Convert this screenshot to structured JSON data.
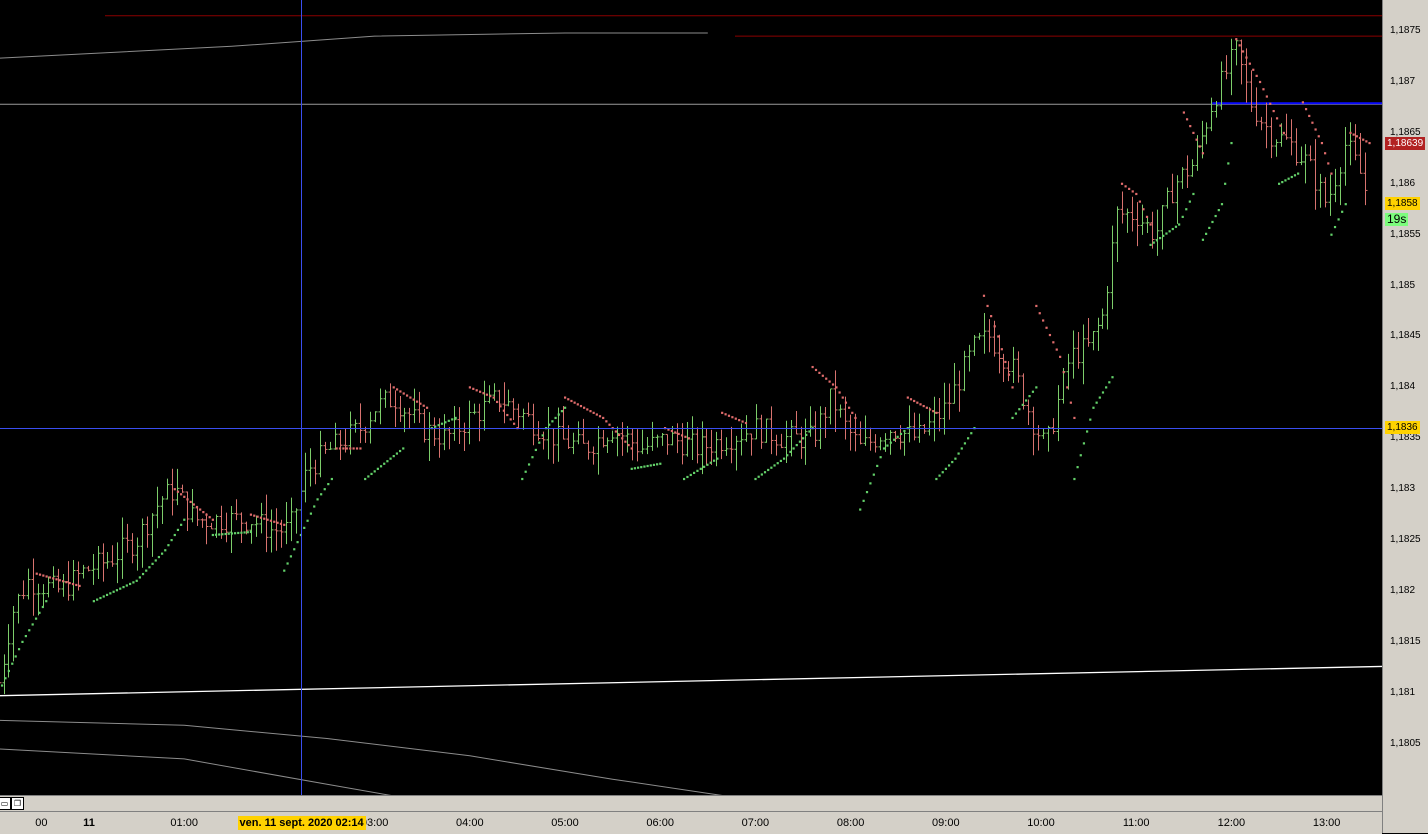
{
  "colors": {
    "background": "#000000",
    "bar_up": "#7ccd6a",
    "bar_down": "#d8736f",
    "sar_up": "#63d16a",
    "sar_down": "#e06c6c",
    "crosshair": "#3a4ef0",
    "resistance_line": "#8b0000",
    "level_line_blue": "#0a0aff",
    "last_price_tag": "#ffd200",
    "bid_tag": "#b22222",
    "timer_tag": "#7cfc7c"
  },
  "y_axis": {
    "ticks": [
      {
        "label": "1,1875",
        "v": 1.1875
      },
      {
        "label": "1,187",
        "v": 1.187
      },
      {
        "label": "1,1865",
        "v": 1.1865
      },
      {
        "label": "1,186",
        "v": 1.186
      },
      {
        "label": "1,1855",
        "v": 1.1855
      },
      {
        "label": "1,185",
        "v": 1.185
      },
      {
        "label": "1,1845",
        "v": 1.1845
      },
      {
        "label": "1,184",
        "v": 1.184
      },
      {
        "label": "1,1835",
        "v": 1.1835
      },
      {
        "label": "1,183",
        "v": 1.183
      },
      {
        "label": "1,1825",
        "v": 1.1825
      },
      {
        "label": "1,182",
        "v": 1.182
      },
      {
        "label": "1,1815",
        "v": 1.1815
      },
      {
        "label": "1,181",
        "v": 1.181
      },
      {
        "label": "1,1805",
        "v": 1.1805
      }
    ],
    "tags": {
      "bid": "1,18639",
      "last": "1,1858",
      "timer": "19s",
      "cursor": "1,1836"
    }
  },
  "x_axis": {
    "labels": [
      {
        "label": "00",
        "t": -0.5
      },
      {
        "label": "11",
        "t": 0,
        "bold": true
      },
      {
        "label": "01:00",
        "t": 1
      },
      {
        "label": "03:00",
        "t": 3
      },
      {
        "label": "04:00",
        "t": 4
      },
      {
        "label": "05:00",
        "t": 5
      },
      {
        "label": "06:00",
        "t": 6
      },
      {
        "label": "07:00",
        "t": 7
      },
      {
        "label": "08:00",
        "t": 8
      },
      {
        "label": "09:00",
        "t": 9
      },
      {
        "label": "10:00",
        "t": 10
      },
      {
        "label": "11:00",
        "t": 11
      },
      {
        "label": "12:00",
        "t": 12
      },
      {
        "label": "13:00",
        "t": 13
      }
    ],
    "cursor_label": "ven. 11 sept. 2020 02:14"
  },
  "chart_data": {
    "type": "line",
    "title": "",
    "xlabel": "",
    "ylabel": "",
    "x_unit": "hours since 11 Sept 2020 00:00",
    "ylim": [
      1.18,
      1.1877
    ],
    "crosshair": {
      "t": 2.23,
      "price": 1.1836
    },
    "horizontal_levels": [
      {
        "name": "resistance",
        "price": 1.18765,
        "style": "dark-red"
      },
      {
        "name": "level",
        "price": 1.18745,
        "style": "dark-red"
      },
      {
        "name": "grey-level",
        "price": 1.18678,
        "style": "grey"
      },
      {
        "name": "blue-level",
        "price": 1.18679,
        "style": "blue",
        "from_t": 11.8
      }
    ],
    "trend_lines": [
      {
        "name": "white-trend",
        "points": [
          [
            -1,
            1.18097
          ],
          [
            13.7,
            1.18126
          ]
        ]
      },
      {
        "name": "upper-grey-curve",
        "points": [
          [
            -1,
            1.18723
          ],
          [
            1.5,
            1.18735
          ],
          [
            3,
            1.18745
          ],
          [
            5,
            1.18748
          ],
          [
            6.5,
            1.18748
          ]
        ]
      },
      {
        "name": "lower-grey-curve-1",
        "points": [
          [
            -1,
            1.18073
          ],
          [
            1,
            1.18068
          ],
          [
            2.5,
            1.18055
          ],
          [
            4,
            1.18038
          ],
          [
            5.5,
            1.18015
          ],
          [
            6.8,
            1.17997
          ]
        ]
      },
      {
        "name": "lower-grey-curve-2",
        "points": [
          [
            -1,
            1.18045
          ],
          [
            1,
            1.18035
          ],
          [
            2.5,
            1.1801
          ],
          [
            3.3,
            1.17997
          ]
        ]
      }
    ],
    "price_path": [
      [
        -0.95,
        1.1811
      ],
      [
        -0.8,
        1.1818
      ],
      [
        -0.65,
        1.1821
      ],
      [
        -0.3,
        1.182
      ],
      [
        -0.05,
        1.1822
      ],
      [
        0.2,
        1.1823
      ],
      [
        0.5,
        1.1825
      ],
      [
        0.75,
        1.1829
      ],
      [
        0.9,
        1.183
      ],
      [
        1.1,
        1.1827
      ],
      [
        1.4,
        1.1827
      ],
      [
        1.7,
        1.1827
      ],
      [
        1.9,
        1.1826
      ],
      [
        2.1,
        1.1826
      ],
      [
        2.3,
        1.1832
      ],
      [
        2.55,
        1.1834
      ],
      [
        2.85,
        1.1836
      ],
      [
        3.0,
        1.1838
      ],
      [
        3.2,
        1.1839
      ],
      [
        3.5,
        1.1836
      ],
      [
        3.75,
        1.1835
      ],
      [
        4.0,
        1.1837
      ],
      [
        4.3,
        1.1839
      ],
      [
        4.6,
        1.1837
      ],
      [
        4.9,
        1.1835
      ],
      [
        5.2,
        1.1834
      ],
      [
        5.5,
        1.1836
      ],
      [
        5.8,
        1.1834
      ],
      [
        6.1,
        1.1835
      ],
      [
        6.4,
        1.1834
      ],
      [
        6.7,
        1.1835
      ],
      [
        7.0,
        1.1836
      ],
      [
        7.3,
        1.1835
      ],
      [
        7.6,
        1.1835
      ],
      [
        7.8,
        1.1839
      ],
      [
        7.95,
        1.1836
      ],
      [
        8.1,
        1.1834
      ],
      [
        8.4,
        1.1836
      ],
      [
        8.7,
        1.1835
      ],
      [
        9.0,
        1.1838
      ],
      [
        9.3,
        1.1844
      ],
      [
        9.45,
        1.1845
      ],
      [
        9.7,
        1.1842
      ],
      [
        9.9,
        1.1837
      ],
      [
        10.05,
        1.1834
      ],
      [
        10.3,
        1.1843
      ],
      [
        10.5,
        1.1844
      ],
      [
        10.65,
        1.1847
      ],
      [
        10.8,
        1.1857
      ],
      [
        11.0,
        1.1857
      ],
      [
        11.2,
        1.1855
      ],
      [
        11.4,
        1.186
      ],
      [
        11.6,
        1.1862
      ],
      [
        11.8,
        1.1868
      ],
      [
        11.95,
        1.1871
      ],
      [
        12.05,
        1.1873
      ],
      [
        12.2,
        1.1868
      ],
      [
        12.4,
        1.1865
      ],
      [
        12.6,
        1.1864
      ],
      [
        12.8,
        1.1862
      ],
      [
        13.0,
        1.1858
      ],
      [
        13.2,
        1.1864
      ],
      [
        13.35,
        1.1861
      ],
      [
        13.45,
        1.1858
      ]
    ],
    "parabolic_sar": [
      {
        "dir": "up",
        "points": [
          [
            -0.95,
            1.181
          ],
          [
            -0.7,
            1.1815
          ],
          [
            -0.45,
            1.1819
          ]
        ]
      },
      {
        "dir": "down",
        "points": [
          [
            -0.55,
            1.18217
          ],
          [
            -0.1,
            1.18205
          ]
        ]
      },
      {
        "dir": "up",
        "points": [
          [
            0.05,
            1.1819
          ],
          [
            0.5,
            1.1821
          ],
          [
            0.8,
            1.1824
          ],
          [
            1.0,
            1.1827
          ]
        ]
      },
      {
        "dir": "down",
        "points": [
          [
            0.9,
            1.183
          ],
          [
            1.3,
            1.1827
          ]
        ]
      },
      {
        "dir": "up",
        "points": [
          [
            1.3,
            1.18255
          ],
          [
            1.7,
            1.18258
          ]
        ]
      },
      {
        "dir": "down",
        "points": [
          [
            1.7,
            1.18275
          ],
          [
            2.05,
            1.18265
          ]
        ]
      },
      {
        "dir": "up",
        "points": [
          [
            2.05,
            1.1822
          ],
          [
            2.4,
            1.1829
          ],
          [
            2.55,
            1.1831
          ]
        ]
      },
      {
        "dir": "down",
        "points": [
          [
            2.6,
            1.1834
          ],
          [
            2.85,
            1.1834
          ]
        ]
      },
      {
        "dir": "up",
        "points": [
          [
            2.9,
            1.1831
          ],
          [
            3.3,
            1.1834
          ]
        ]
      },
      {
        "dir": "down",
        "points": [
          [
            3.2,
            1.184
          ],
          [
            3.55,
            1.1838
          ]
        ]
      },
      {
        "dir": "up",
        "points": [
          [
            3.6,
            1.1836
          ],
          [
            3.85,
            1.1837
          ]
        ]
      },
      {
        "dir": "down",
        "points": [
          [
            4.0,
            1.184
          ],
          [
            4.25,
            1.1839
          ],
          [
            4.5,
            1.1836
          ]
        ]
      },
      {
        "dir": "up",
        "points": [
          [
            4.55,
            1.1831
          ],
          [
            4.8,
            1.1836
          ],
          [
            5.0,
            1.1838
          ]
        ]
      },
      {
        "dir": "down",
        "points": [
          [
            5.0,
            1.1839
          ],
          [
            5.4,
            1.1837
          ],
          [
            5.7,
            1.1834
          ]
        ]
      },
      {
        "dir": "up",
        "points": [
          [
            5.7,
            1.1832
          ],
          [
            6.0,
            1.18325
          ]
        ]
      },
      {
        "dir": "down",
        "points": [
          [
            6.05,
            1.1836
          ],
          [
            6.3,
            1.1835
          ]
        ]
      },
      {
        "dir": "up",
        "points": [
          [
            6.25,
            1.1831
          ],
          [
            6.6,
            1.1833
          ]
        ]
      },
      {
        "dir": "down",
        "points": [
          [
            6.65,
            1.18375
          ],
          [
            6.9,
            1.18365
          ]
        ]
      },
      {
        "dir": "up",
        "points": [
          [
            7.0,
            1.1831
          ],
          [
            7.3,
            1.1833
          ],
          [
            7.6,
            1.1836
          ]
        ]
      },
      {
        "dir": "down",
        "points": [
          [
            7.6,
            1.1842
          ],
          [
            7.85,
            1.184
          ],
          [
            8.05,
            1.1837
          ]
        ]
      },
      {
        "dir": "up",
        "points": [
          [
            8.1,
            1.1828
          ],
          [
            8.35,
            1.1834
          ],
          [
            8.6,
            1.1836
          ]
        ]
      },
      {
        "dir": "down",
        "points": [
          [
            8.6,
            1.1839
          ],
          [
            8.9,
            1.18375
          ]
        ]
      },
      {
        "dir": "up",
        "points": [
          [
            8.9,
            1.1831
          ],
          [
            9.1,
            1.1833
          ],
          [
            9.3,
            1.1836
          ]
        ]
      },
      {
        "dir": "down",
        "points": [
          [
            9.4,
            1.1849
          ],
          [
            9.55,
            1.1845
          ],
          [
            9.7,
            1.184
          ]
        ]
      },
      {
        "dir": "up",
        "points": [
          [
            9.7,
            1.1837
          ],
          [
            9.95,
            1.184
          ]
        ]
      },
      {
        "dir": "down",
        "points": [
          [
            9.95,
            1.1848
          ],
          [
            10.2,
            1.1843
          ],
          [
            10.35,
            1.1837
          ]
        ]
      },
      {
        "dir": "up",
        "points": [
          [
            10.35,
            1.1831
          ],
          [
            10.55,
            1.1838
          ],
          [
            10.75,
            1.1841
          ]
        ]
      },
      {
        "dir": "down",
        "points": [
          [
            10.85,
            1.186
          ],
          [
            11.0,
            1.1859
          ],
          [
            11.15,
            1.1856
          ]
        ]
      },
      {
        "dir": "up",
        "points": [
          [
            11.15,
            1.1854
          ],
          [
            11.45,
            1.1856
          ],
          [
            11.6,
            1.1859
          ]
        ]
      },
      {
        "dir": "down",
        "points": [
          [
            11.5,
            1.1867
          ],
          [
            11.7,
            1.1863
          ]
        ]
      },
      {
        "dir": "up",
        "points": [
          [
            11.7,
            1.18545
          ],
          [
            11.9,
            1.1858
          ],
          [
            12.0,
            1.1864
          ]
        ]
      },
      {
        "dir": "down",
        "points": [
          [
            12.05,
            1.18742
          ],
          [
            12.3,
            1.187
          ],
          [
            12.55,
            1.1865
          ]
        ]
      },
      {
        "dir": "up",
        "points": [
          [
            12.5,
            1.186
          ],
          [
            12.7,
            1.1861
          ]
        ]
      },
      {
        "dir": "down",
        "points": [
          [
            12.75,
            1.1868
          ],
          [
            12.95,
            1.1864
          ],
          [
            13.05,
            1.1861
          ]
        ]
      },
      {
        "dir": "up",
        "points": [
          [
            13.05,
            1.1855
          ],
          [
            13.2,
            1.1858
          ]
        ]
      },
      {
        "dir": "down",
        "points": [
          [
            13.25,
            1.1865
          ],
          [
            13.45,
            1.1864
          ]
        ]
      }
    ]
  }
}
